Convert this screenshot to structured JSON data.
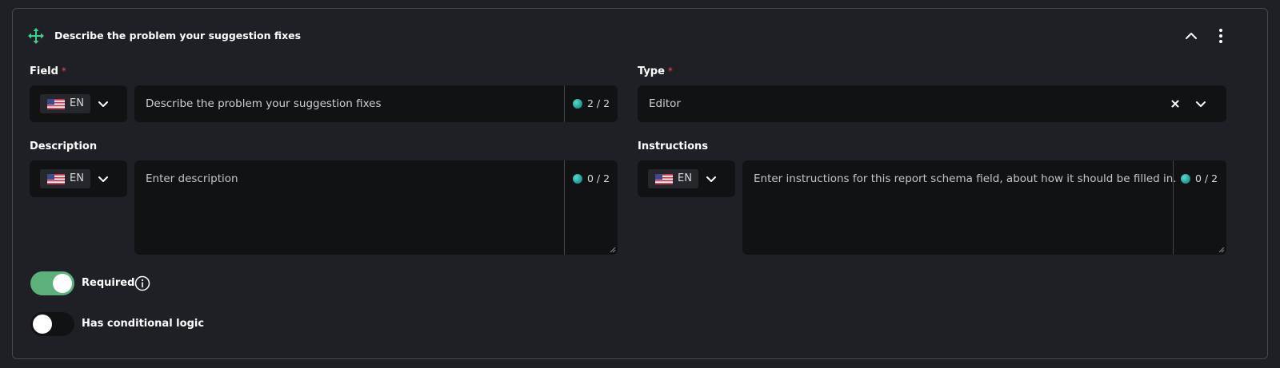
{
  "header": {
    "title": "Describe the problem your suggestion fixes",
    "move_icon": "move-arrows-icon",
    "collapse_icon": "chevron-up-icon",
    "menu_icon": "vertical-dots-icon"
  },
  "field": {
    "label": "Field",
    "required_mark": "*",
    "language": "EN",
    "value": "Describe the problem your suggestion fixes",
    "translations": "2 / 2"
  },
  "type": {
    "label": "Type",
    "required_mark": "*",
    "value": "Editor"
  },
  "description": {
    "label": "Description",
    "language": "EN",
    "placeholder": "Enter description",
    "translations": "0 / 2"
  },
  "instructions": {
    "label": "Instructions",
    "language": "EN",
    "placeholder": "Enter instructions for this report schema field, about how it should be filled in.",
    "translations": "0 / 2"
  },
  "toggles": {
    "required": {
      "label": "Required",
      "on": true
    },
    "conditional": {
      "label": "Has conditional logic",
      "on": false
    }
  },
  "colors": {
    "accent_green": "#5cb07a",
    "icon_green": "#3ecf8e",
    "required_red": "#e5484d",
    "background": "#1f2025",
    "input_bg": "#111214"
  }
}
